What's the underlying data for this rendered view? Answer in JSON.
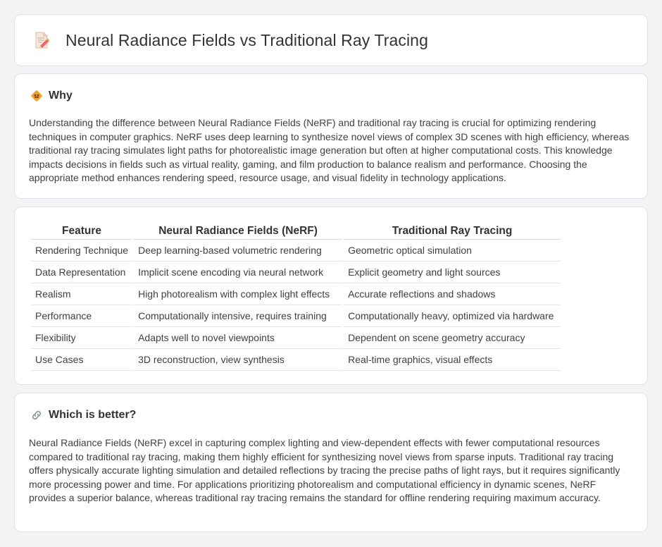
{
  "header": {
    "title": "Neural Radiance Fields vs Traditional Ray Tracing",
    "icon": "document-pencil-icon"
  },
  "why": {
    "icon": "diamond-sign-icon",
    "title": "Why",
    "body": "Understanding the difference between Neural Radiance Fields (NeRF) and traditional ray tracing is crucial for optimizing rendering techniques in computer graphics. NeRF uses deep learning to synthesize novel views of complex 3D scenes with high efficiency, whereas traditional ray tracing simulates light paths for photorealistic image generation but often at higher computational costs. This knowledge impacts decisions in fields such as virtual reality, gaming, and film production to balance realism and performance. Choosing the appropriate method enhances rendering speed, resource usage, and visual fidelity in technology applications."
  },
  "table": {
    "headers": [
      "Feature",
      "Neural Radiance Fields (NeRF)",
      "Traditional Ray Tracing"
    ],
    "rows": [
      [
        "Rendering Technique",
        "Deep learning-based volumetric rendering",
        "Geometric optical simulation"
      ],
      [
        "Data Representation",
        "Implicit scene encoding via neural network",
        "Explicit geometry and light sources"
      ],
      [
        "Realism",
        "High photorealism with complex light effects",
        "Accurate reflections and shadows"
      ],
      [
        "Performance",
        "Computationally intensive, requires training",
        "Computationally heavy, optimized via hardware"
      ],
      [
        "Flexibility",
        "Adapts well to novel viewpoints",
        "Dependent on scene geometry accuracy"
      ],
      [
        "Use Cases",
        "3D reconstruction, view synthesis",
        "Real-time graphics, visual effects"
      ]
    ]
  },
  "better": {
    "icon": "link-icon",
    "title": "Which is better?",
    "body": "Neural Radiance Fields (NeRF) excel in capturing complex lighting and view-dependent effects with fewer computational resources compared to traditional ray tracing, making them highly efficient for synthesizing novel views from sparse inputs. Traditional ray tracing offers physically accurate lighting simulation and detailed reflections by tracing the precise paths of light rays, but it requires significantly more processing power and time. For applications prioritizing photorealism and computational efficiency in dynamic scenes, NeRF provides a superior balance, whereas traditional ray tracing remains the standard for offline rendering requiring maximum accuracy."
  },
  "colors": {
    "background": "#f3f3f5",
    "card": "#ffffff",
    "icon_orange": "#f0a030",
    "icon_pink": "#e86a6a"
  }
}
